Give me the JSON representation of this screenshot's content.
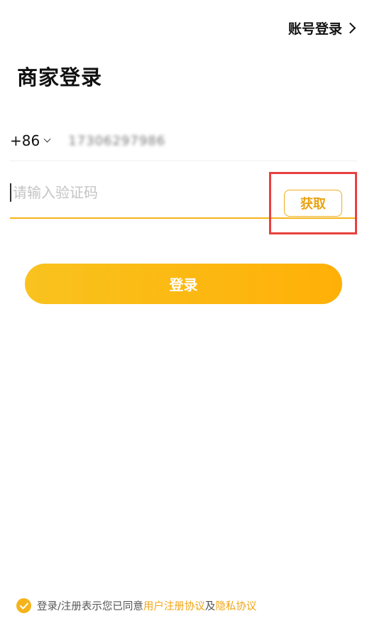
{
  "header": {
    "account_login_label": "账号登录"
  },
  "page": {
    "title": "商家登录"
  },
  "phone": {
    "country_code": "+86",
    "number_masked": "17306297986"
  },
  "verification": {
    "placeholder": "请输入验证码",
    "get_code_label": "获取"
  },
  "actions": {
    "login_label": "登录"
  },
  "agreement": {
    "prefix": "登录/注册表示您已同意",
    "user_agreement": "用户注册协议",
    "conjunction": "及",
    "privacy_policy": "隐私协议",
    "checked": true
  },
  "colors": {
    "accent": "#f5b41a",
    "highlight_box": "#e8413f",
    "link": "#f0a616"
  },
  "icons": {
    "account_login_chevron": "chevron-right-icon",
    "country_dropdown": "chevron-down-icon",
    "agreement_check": "check-icon"
  }
}
